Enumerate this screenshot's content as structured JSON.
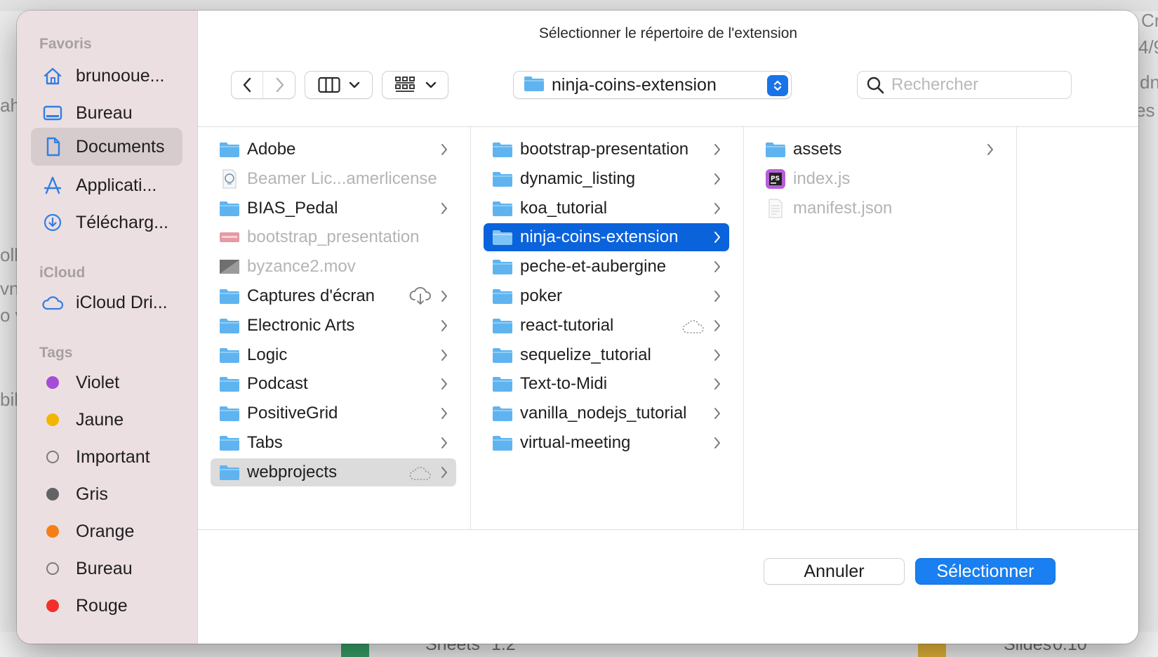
{
  "background": {
    "bottom_left_label": "Sheets",
    "bottom_left_value": "1.2",
    "bottom_right_label": "Slides",
    "bottom_right_value": "0.10",
    "side_fragments": [
      "ah",
      "oll",
      "vn",
      "o v",
      "bil",
      "Cr",
      "4/9",
      "dn",
      "es p"
    ]
  },
  "dialog": {
    "title": "Sélectionner le répertoire de l'extension"
  },
  "sidebar": {
    "favoris_label": "Favoris",
    "favoris": [
      {
        "label": "brunooue...",
        "icon": "home-icon"
      },
      {
        "label": "Bureau",
        "icon": "desktop-icon"
      },
      {
        "label": "Documents",
        "icon": "document-icon",
        "selected": true
      },
      {
        "label": "Applicati...",
        "icon": "applications-icon"
      },
      {
        "label": "Télécharg...",
        "icon": "download-icon"
      }
    ],
    "icloud_label": "iCloud",
    "icloud": [
      {
        "label": "iCloud Dri...",
        "icon": "icloud-icon"
      }
    ],
    "tags_label": "Tags",
    "tags": [
      {
        "label": "Violet",
        "color": "#a64cd6",
        "style": "dot"
      },
      {
        "label": "Jaune",
        "color": "#f2b600",
        "style": "dot"
      },
      {
        "label": "Important",
        "color": "#7c7c7c",
        "style": "ring"
      },
      {
        "label": "Gris",
        "color": "#636366",
        "style": "dot"
      },
      {
        "label": "Orange",
        "color": "#f57f17",
        "style": "dot"
      },
      {
        "label": "Bureau",
        "color": "#7c7c7c",
        "style": "ring"
      },
      {
        "label": "Rouge",
        "color": "#f2302b",
        "style": "dot"
      }
    ]
  },
  "toolbar": {
    "path_popup_label": "ninja-coins-extension",
    "search_placeholder": "Rechercher",
    "view_mode": "columns",
    "group_mode": "grid"
  },
  "columns": [
    {
      "items": [
        {
          "label": "Adobe",
          "kind": "folder",
          "disabled": false,
          "chevron": true
        },
        {
          "label": "Beamer Lic...amerlicense",
          "kind": "license",
          "disabled": true,
          "chevron": false
        },
        {
          "label": "BIAS_Pedal",
          "kind": "folder",
          "disabled": false,
          "chevron": true
        },
        {
          "label": "bootstrap_presentation",
          "kind": "keynote",
          "disabled": true,
          "chevron": false
        },
        {
          "label": "byzance2.mov",
          "kind": "movie",
          "disabled": true,
          "chevron": false
        },
        {
          "label": "Captures d'écran",
          "kind": "folder",
          "disabled": false,
          "chevron": true,
          "cloud": "download"
        },
        {
          "label": "Electronic Arts",
          "kind": "folder",
          "disabled": false,
          "chevron": true
        },
        {
          "label": "Logic",
          "kind": "folder",
          "disabled": false,
          "chevron": true
        },
        {
          "label": "Podcast",
          "kind": "folder",
          "disabled": false,
          "chevron": true
        },
        {
          "label": "PositiveGrid",
          "kind": "folder",
          "disabled": false,
          "chevron": true
        },
        {
          "label": "Tabs",
          "kind": "folder",
          "disabled": false,
          "chevron": true
        },
        {
          "label": "webprojects",
          "kind": "folder",
          "disabled": false,
          "chevron": true,
          "cloud": "dotted",
          "highlight": "gray"
        }
      ]
    },
    {
      "items": [
        {
          "label": "bootstrap-presentation",
          "kind": "folder",
          "disabled": false,
          "chevron": true
        },
        {
          "label": "dynamic_listing",
          "kind": "folder",
          "disabled": false,
          "chevron": true
        },
        {
          "label": "koa_tutorial",
          "kind": "folder",
          "disabled": false,
          "chevron": true
        },
        {
          "label": "ninja-coins-extension",
          "kind": "folder",
          "disabled": false,
          "chevron": true,
          "highlight": "blue"
        },
        {
          "label": "peche-et-aubergine",
          "kind": "folder",
          "disabled": false,
          "chevron": true
        },
        {
          "label": "poker",
          "kind": "folder",
          "disabled": false,
          "chevron": true
        },
        {
          "label": "react-tutorial",
          "kind": "folder",
          "disabled": false,
          "chevron": true,
          "cloud": "dotted"
        },
        {
          "label": "sequelize_tutorial",
          "kind": "folder",
          "disabled": false,
          "chevron": true
        },
        {
          "label": "Text-to-Midi",
          "kind": "folder",
          "disabled": false,
          "chevron": true
        },
        {
          "label": "vanilla_nodejs_tutorial",
          "kind": "folder",
          "disabled": false,
          "chevron": true
        },
        {
          "label": "virtual-meeting",
          "kind": "folder",
          "disabled": false,
          "chevron": true
        }
      ]
    },
    {
      "items": [
        {
          "label": "assets",
          "kind": "folder",
          "disabled": false,
          "chevron": true
        },
        {
          "label": "index.js",
          "kind": "phpstorm",
          "disabled": true,
          "chevron": false
        },
        {
          "label": "manifest.json",
          "kind": "textfile",
          "disabled": true,
          "chevron": false
        }
      ]
    }
  ],
  "buttons": {
    "cancel_label": "Annuler",
    "select_label": "Sélectionner"
  },
  "colors": {
    "accent": "#1a7ff0",
    "selection": "#0b63dc",
    "folder": "#5fb4f0",
    "sidebar_bg": "#ecdfe1"
  }
}
